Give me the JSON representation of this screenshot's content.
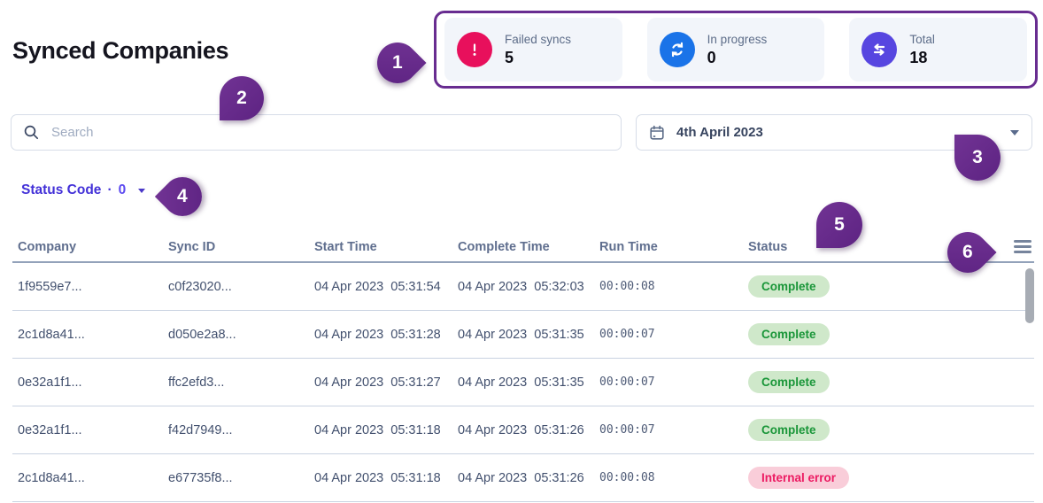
{
  "page": {
    "title": "Synced Companies"
  },
  "stats": {
    "cards": [
      {
        "label": "Failed syncs",
        "value": "5",
        "icon": "alert-icon",
        "color": "#e8105c"
      },
      {
        "label": "In progress",
        "value": "0",
        "icon": "sync-icon",
        "color": "#1a73e8"
      },
      {
        "label": "Total",
        "value": "18",
        "icon": "transfer-icon",
        "color": "#5746e0"
      }
    ]
  },
  "search": {
    "placeholder": "Search",
    "value": ""
  },
  "date_picker": {
    "value": "4th April 2023",
    "icon": "calendar-icon"
  },
  "filter": {
    "label": "Status Code",
    "separator": "·",
    "count": "0"
  },
  "table": {
    "columns": [
      "Company",
      "Sync ID",
      "Start Time",
      "Complete Time",
      "Run Time",
      "Status"
    ],
    "rows": [
      {
        "company": "1f9559e7...",
        "sync_id": "c0f23020...",
        "start_time": "04 Apr 2023  05:31:54",
        "complete_time": "04 Apr 2023  05:32:03",
        "run_time": "00:00:08",
        "status": "Complete",
        "status_type": "success"
      },
      {
        "company": "2c1d8a41...",
        "sync_id": "d050e2a8...",
        "start_time": "04 Apr 2023  05:31:28",
        "complete_time": "04 Apr 2023  05:31:35",
        "run_time": "00:00:07",
        "status": "Complete",
        "status_type": "success"
      },
      {
        "company": "0e32a1f1...",
        "sync_id": "ffc2efd3...",
        "start_time": "04 Apr 2023  05:31:27",
        "complete_time": "04 Apr 2023  05:31:35",
        "run_time": "00:00:07",
        "status": "Complete",
        "status_type": "success"
      },
      {
        "company": "0e32a1f1...",
        "sync_id": "f42d7949...",
        "start_time": "04 Apr 2023  05:31:18",
        "complete_time": "04 Apr 2023  05:31:26",
        "run_time": "00:00:07",
        "status": "Complete",
        "status_type": "success"
      },
      {
        "company": "2c1d8a41...",
        "sync_id": "e67735f8...",
        "start_time": "04 Apr 2023  05:31:18",
        "complete_time": "04 Apr 2023  05:31:26",
        "run_time": "00:00:08",
        "status": "Internal error",
        "status_type": "error"
      }
    ]
  },
  "annotations": {
    "markers": [
      "1",
      "2",
      "3",
      "4",
      "5",
      "6"
    ],
    "marker_color": "#682c90"
  }
}
